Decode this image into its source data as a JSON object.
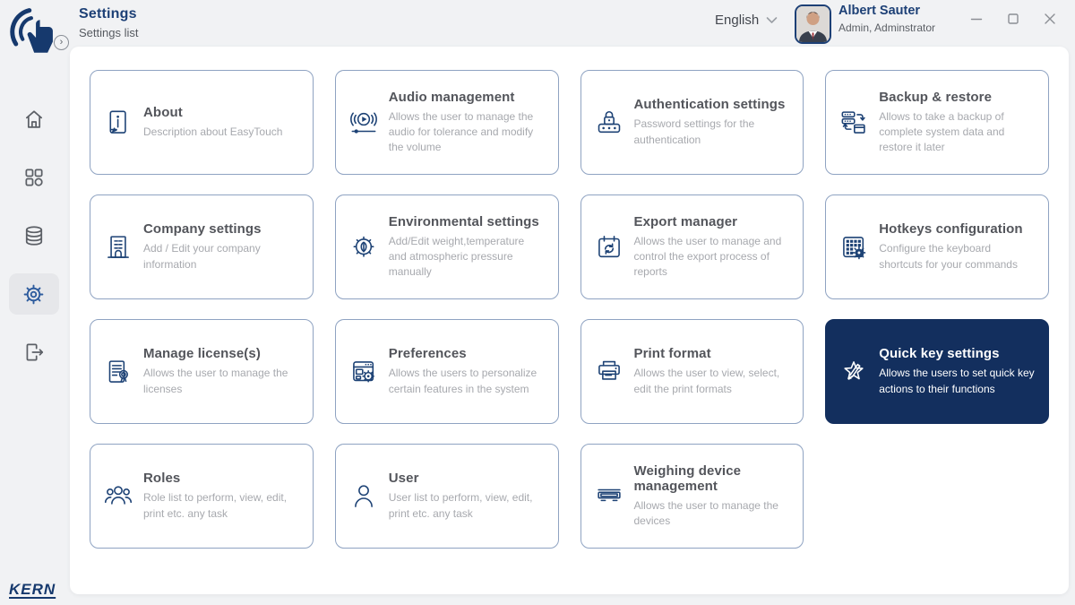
{
  "header": {
    "title": "Settings",
    "subtitle": "Settings list",
    "language": "English",
    "user_name": "Albert Sauter",
    "user_role": "Admin, Adminstrator"
  },
  "window_controls": {
    "minimize": "minimize",
    "maximize": "maximize",
    "close": "close"
  },
  "sidebar": {
    "brand": "KERN",
    "expand_glyph": "›",
    "items": [
      {
        "name": "home",
        "active": false
      },
      {
        "name": "apps",
        "active": false
      },
      {
        "name": "database",
        "active": false
      },
      {
        "name": "settings",
        "active": true
      },
      {
        "name": "logout",
        "active": false
      }
    ]
  },
  "colors": {
    "navy": "#16396d",
    "active_card_bg": "#132f5e",
    "card_border": "#8fa3c2",
    "page_bg": "#f1f2f4",
    "title_text": "#53555b",
    "desc_text": "#a7a9ae"
  },
  "cards": [
    {
      "title": "About",
      "description": "Description about EasyTouch",
      "icon": "about-icon",
      "active": false
    },
    {
      "title": "Audio management",
      "description": "Allows the user to manage the audio for tolerance and modify the volume",
      "icon": "audio-icon",
      "active": false
    },
    {
      "title": "Authentication settings",
      "description": "Password settings for the authentication",
      "icon": "lock-keypad-icon",
      "active": false
    },
    {
      "title": "Backup & restore",
      "description": "Allows to take a backup of complete system data and restore it later",
      "icon": "backup-restore-icon",
      "active": false
    },
    {
      "title": "Company settings",
      "description": "Add / Edit your company information",
      "icon": "building-icon",
      "active": false
    },
    {
      "title": "Environmental settings",
      "description": "Add/Edit weight,temperature and atmospheric pressure manually",
      "icon": "eco-gear-icon",
      "active": false
    },
    {
      "title": "Export manager",
      "description": "Allows the user to manage and control the export process of reports",
      "icon": "export-calendar-icon",
      "active": false
    },
    {
      "title": "Hotkeys configuration",
      "description": "Configure the keyboard shortcuts for your commands",
      "icon": "hotkeys-keypad-icon",
      "active": false
    },
    {
      "title": "Manage license(s)",
      "description": "Allows the user to manage the licenses",
      "icon": "license-certificate-icon",
      "active": false
    },
    {
      "title": "Preferences",
      "description": "Allows the users to personalize certain features in the system",
      "icon": "preferences-window-icon",
      "active": false
    },
    {
      "title": "Print format",
      "description": "Allows the user to view, select, edit the print formats",
      "icon": "printer-icon",
      "active": false
    },
    {
      "title": "Quick key settings",
      "description": "Allows the users to set quick key actions to their functions",
      "icon": "quick-key-star-icon",
      "active": true
    },
    {
      "title": "Roles",
      "description": "Role list to perform, view, edit, print etc. any task",
      "icon": "roles-group-icon",
      "active": false
    },
    {
      "title": "User",
      "description": "User list to perform, view, edit, print etc. any task",
      "icon": "user-icon",
      "active": false
    },
    {
      "title": "Weighing device management",
      "description": "Allows the user to manage the devices",
      "icon": "weighing-scale-icon",
      "active": false
    }
  ]
}
